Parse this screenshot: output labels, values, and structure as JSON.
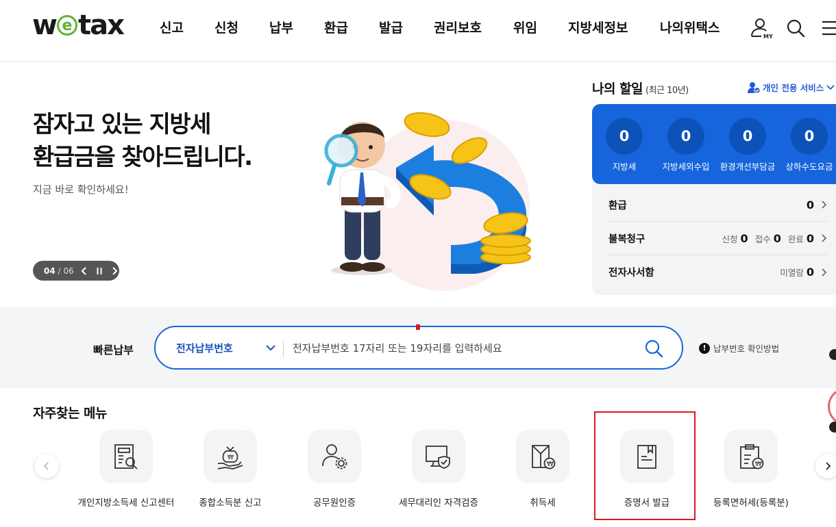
{
  "header": {
    "logo": {
      "pre": "w",
      "mid": "e",
      "post": "tax"
    },
    "nav": [
      "신고",
      "신청",
      "납부",
      "환급",
      "발급",
      "권리보호",
      "위임",
      "지방세정보",
      "나의위택스"
    ],
    "my_icon_label": "MY",
    "icons": [
      "user-my-icon",
      "search-icon",
      "menu-icon"
    ]
  },
  "hero": {
    "title": "잠자고 있는 지방세\n환급금을 찾아드립니다.",
    "subtitle": "지금 바로 확인하세요!",
    "slide_current": "04",
    "slide_total": "/ 06"
  },
  "my_discount": {
    "title": "나의 할일",
    "period": "(최근 10년)",
    "personal_service": "개인 전용 서비스",
    "stats": [
      {
        "value": "0",
        "label": "지방세"
      },
      {
        "value": "0",
        "label": "지방세외수입"
      },
      {
        "value": "0",
        "label": "환경개선부담금"
      },
      {
        "value": "0",
        "label": "상하수도요금"
      }
    ],
    "refund": {
      "label": "환급",
      "value": "0"
    },
    "objection": {
      "label": "불복청구",
      "apply_label": "신청",
      "apply_value": "0",
      "receipt_label": "접수",
      "receipt_value": "0",
      "done_label": "완료",
      "done_value": "0"
    },
    "mailbox": {
      "label": "전자사서함",
      "unread_label": "미열람",
      "unread_value": "0"
    }
  },
  "quick_pay": {
    "label": "빠른납부",
    "select_value": "전자납부번호",
    "placeholder": "전자납부번호 17자리 또는 19자리를 입력하세요",
    "howto": "납부번호 확인방법"
  },
  "frequent_menu": {
    "title": "자주찾는 메뉴",
    "items": [
      {
        "label": "개인지방소득세 신고센터",
        "icon": "form-search-icon"
      },
      {
        "label": "종합소득분 신고",
        "icon": "money-bag-hand-icon"
      },
      {
        "label": "공무원인증",
        "icon": "person-gear-icon"
      },
      {
        "label": "세무대리인 자격검증",
        "icon": "monitor-shield-icon"
      },
      {
        "label": "취득세",
        "icon": "document-won-icon"
      },
      {
        "label": "증명서 발급",
        "icon": "certificate-icon"
      },
      {
        "label": "등록면허세(등록분)",
        "icon": "clipboard-won-icon"
      }
    ]
  },
  "colors": {
    "brand_blue": "#1665dc",
    "logo_green": "#5cb531",
    "highlight_red": "#e01818"
  }
}
